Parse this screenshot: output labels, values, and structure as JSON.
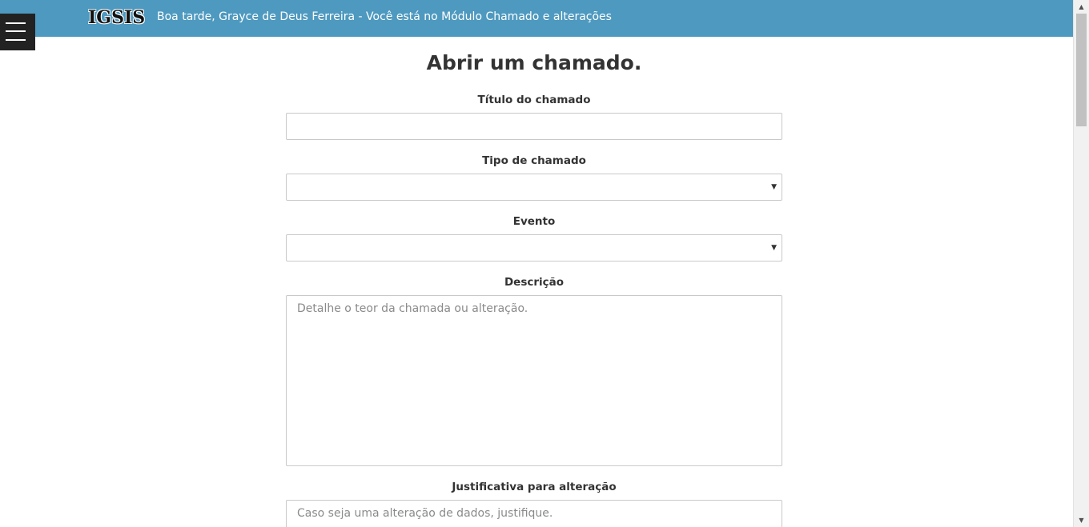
{
  "header": {
    "logo": "IGSIS",
    "greeting": "Boa tarde, Grayce de Deus Ferreira - Você está no Módulo Chamado e alterações",
    "menu_icon": "hamburger-menu-icon",
    "bar_color": "#4e99bf"
  },
  "form": {
    "title": "Abrir um chamado.",
    "titulo": {
      "label": "Título do chamado",
      "value": ""
    },
    "tipo": {
      "label": "Tipo de chamado",
      "selected": ""
    },
    "evento": {
      "label": "Evento",
      "selected": ""
    },
    "descricao": {
      "label": "Descrição",
      "placeholder": "Detalhe o teor da chamada ou alteração."
    },
    "justificativa": {
      "label": "Justificativa para alteração",
      "placeholder": "Caso seja uma alteração de dados, justifique."
    }
  }
}
